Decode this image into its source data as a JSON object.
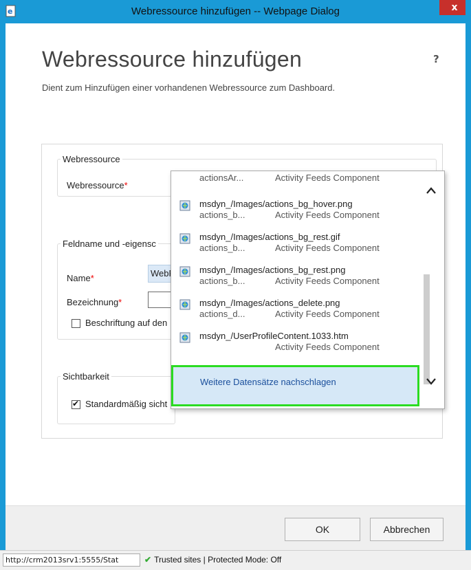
{
  "window": {
    "title": "Webressource hinzufügen -- Webpage Dialog",
    "close_label": "x",
    "accent": "#1a9ad6"
  },
  "page": {
    "heading": "Webressource hinzufügen",
    "help_label": "?",
    "description": "Dient zum Hinzufügen einer vorhandenen Webressource zum Dashboard."
  },
  "form": {
    "webressource_group": "Webressource",
    "webressource_label": "Webressource",
    "field_group": "Feldname und -eigensc",
    "name_label": "Name",
    "name_value": "WebRe",
    "bezeichnung_label": "Bezeichnung",
    "beschriftung_label": "Beschriftung auf den",
    "sichtbarkeit_group": "Sichtbarkeit",
    "standard_label": "Standardmäßig sicht",
    "required_marker": "*",
    "lookup_icon": "lookup-icon"
  },
  "lookup": {
    "items": [
      {
        "name": "",
        "sub1": "actionsAr...",
        "sub2": "Activity Feeds Component"
      },
      {
        "name": "msdyn_/Images/actions_bg_hover.png",
        "sub1": "actions_b...",
        "sub2": "Activity Feeds Component"
      },
      {
        "name": "msdyn_/Images/actions_bg_rest.gif",
        "sub1": "actions_b...",
        "sub2": "Activity Feeds Component"
      },
      {
        "name": "msdyn_/Images/actions_bg_rest.png",
        "sub1": "actions_b...",
        "sub2": "Activity Feeds Component"
      },
      {
        "name": "msdyn_/Images/actions_delete.png",
        "sub1": "actions_d...",
        "sub2": "Activity Feeds Component"
      },
      {
        "name": "msdyn_/UserProfileContent.1033.htm",
        "sub1": "",
        "sub2": "Activity Feeds Component"
      }
    ],
    "more_label": "Weitere Datensätze nachschlagen"
  },
  "footer": {
    "ok_label": "OK",
    "cancel_label": "Abbrechen"
  },
  "status": {
    "url": "http://crm2013srv1:5555/Stat",
    "trust": "Trusted sites | Protected Mode: Off"
  }
}
